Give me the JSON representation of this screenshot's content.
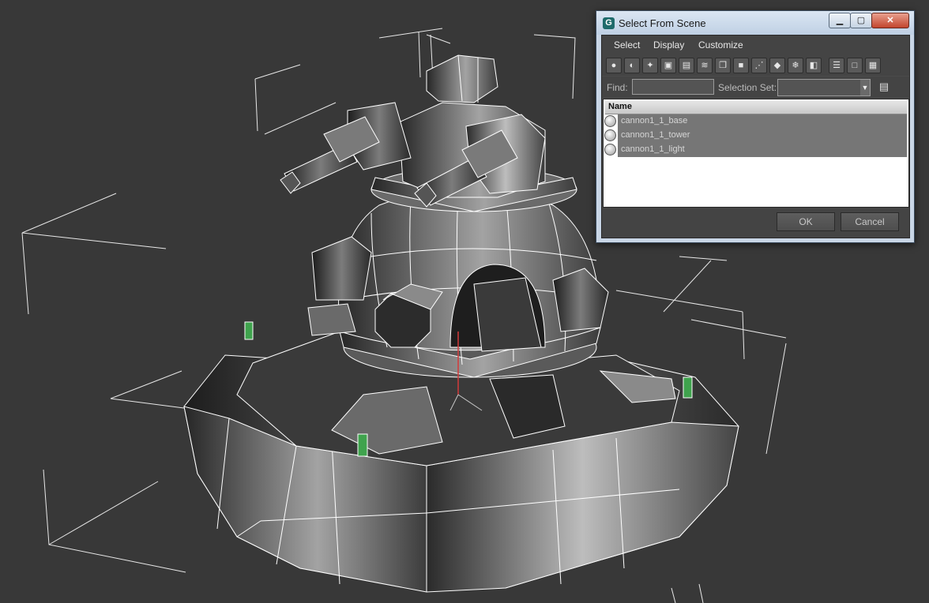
{
  "dialog": {
    "title": "Select From Scene",
    "app_icon": "G",
    "menu": [
      "Select",
      "Display",
      "Customize"
    ],
    "toolbar_icons": [
      "display-geometry-icon",
      "display-shapes-icon",
      "display-lights-icon",
      "display-cameras-icon",
      "display-helpers-icon",
      "display-spacewarps-icon",
      "display-groups-icon",
      "display-xrefs-icon",
      "display-bones-icon",
      "display-containers-icon",
      "display-frozen-icon",
      "display-hidden-icon",
      "select-all-icon",
      "select-none-icon",
      "select-invert-icon"
    ],
    "find_label": "Find:",
    "find_value": "",
    "selection_set_label": "Selection Set:",
    "selection_set_value": "",
    "column_name": "Name",
    "rows": [
      {
        "label": "cannon1_1_base"
      },
      {
        "label": "cannon1_1_tower"
      },
      {
        "label": "cannon1_1_light"
      }
    ],
    "ok_label": "OK",
    "cancel_label": "Cancel"
  },
  "colors": {
    "viewport_bg": "#383838",
    "wire": "#ffffff",
    "light_marker": "#3fa34d",
    "row_highlight": "#767676"
  }
}
